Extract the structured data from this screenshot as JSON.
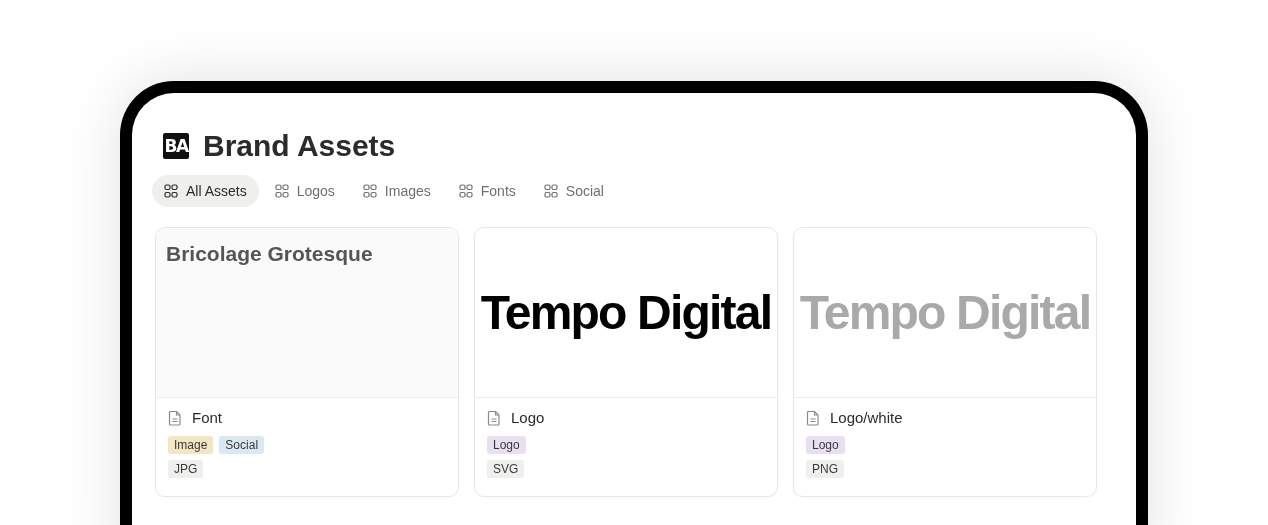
{
  "page": {
    "icon_text": "BA",
    "title": "Brand Assets"
  },
  "tabs": [
    {
      "label": "All Assets",
      "selected": true
    },
    {
      "label": "Logos",
      "selected": false
    },
    {
      "label": "Images",
      "selected": false
    },
    {
      "label": "Fonts",
      "selected": false
    },
    {
      "label": "Social",
      "selected": false
    }
  ],
  "cards": [
    {
      "preview": {
        "kind": "font-sample",
        "text": "Bricolage Grotesque"
      },
      "name": "Font",
      "tags": [
        {
          "label": "Image",
          "color": "#f5e6c3"
        },
        {
          "label": "Social",
          "color": "#dbe7f3"
        }
      ],
      "file_type": "JPG"
    },
    {
      "preview": {
        "kind": "wordmark",
        "light": false,
        "text": "Tempo Digital"
      },
      "name": "Logo",
      "tags": [
        {
          "label": "Logo",
          "color": "#e9dff3"
        }
      ],
      "file_type": "SVG"
    },
    {
      "preview": {
        "kind": "wordmark",
        "light": true,
        "text": "Tempo Digital"
      },
      "name": "Logo/white",
      "tags": [
        {
          "label": "Logo",
          "color": "#e9dff3"
        }
      ],
      "file_type": "PNG"
    }
  ]
}
